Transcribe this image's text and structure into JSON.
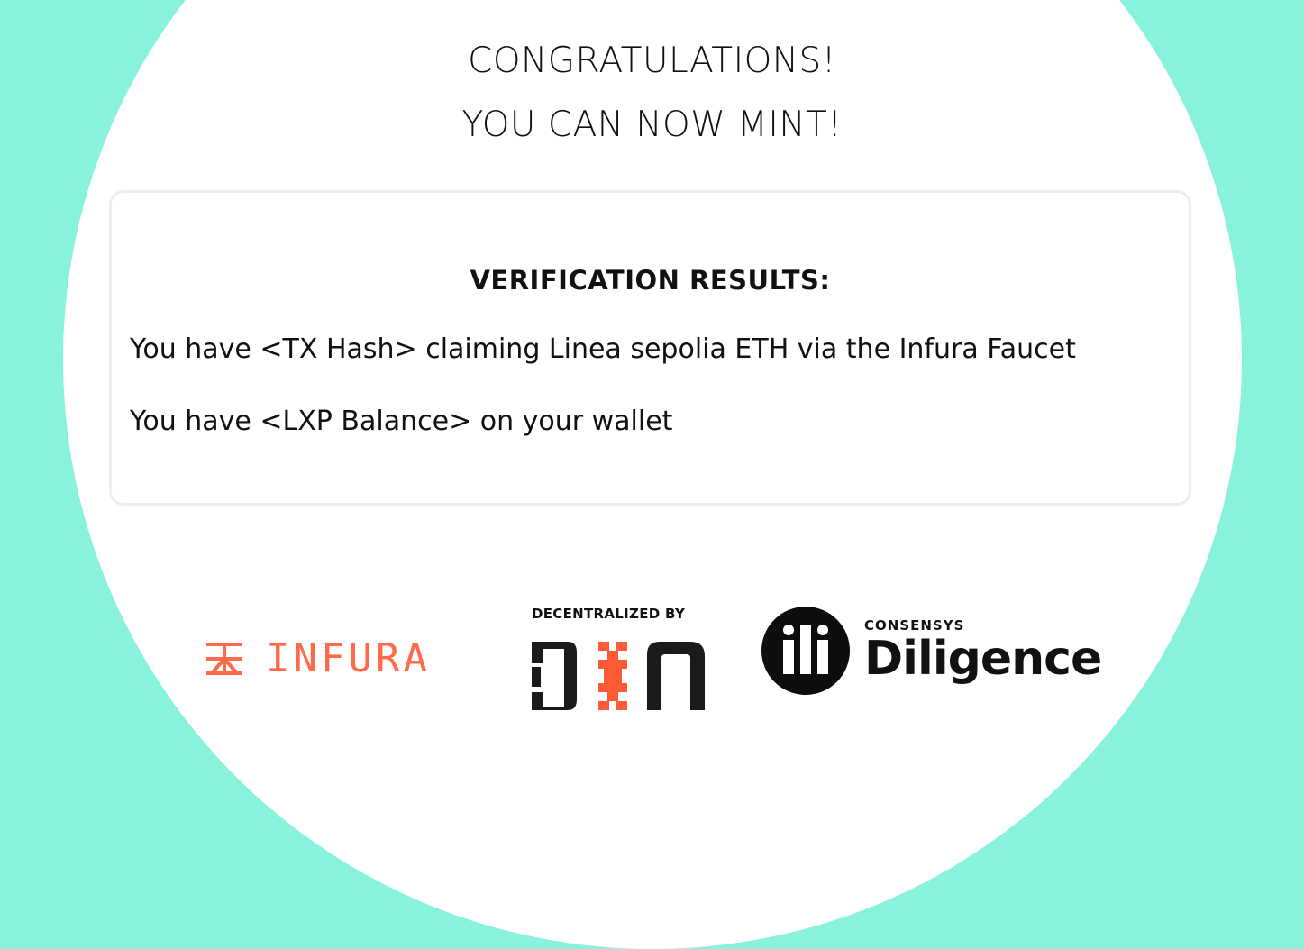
{
  "header": {
    "line1": "CONGRATULATIONS!",
    "line2": "YOU CAN NOW MINT!"
  },
  "verification": {
    "title": "VERIFICATION RESULTS:",
    "items": [
      "You have <TX Hash> claiming Linea sepolia ETH via the Infura Faucet",
      "You have <LXP Balance> on your wallet"
    ]
  },
  "sponsors": {
    "infura": {
      "name": "INFURA",
      "icon": "infura-logo-icon",
      "color": "#ff6b4a"
    },
    "din": {
      "label": "DECENTRALIZED BY",
      "icon": "din-logo-icon",
      "accent": "#ff5a36"
    },
    "diligence": {
      "small": "CONSENSYS",
      "big": "Diligence",
      "icon": "diligence-logo-icon"
    }
  },
  "colors": {
    "background": "#88f2dc",
    "circle": "#ffffff",
    "card_border": "#eeeeee"
  }
}
